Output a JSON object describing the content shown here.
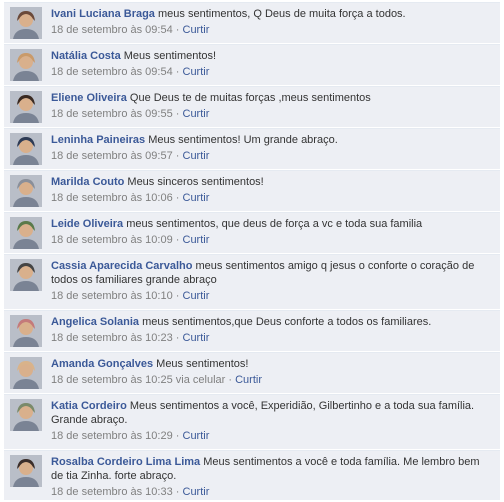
{
  "comments": [
    {
      "author": "Ivani Luciana Braga",
      "text": "meus sentimentos, Q Deus de muita força a todos.",
      "time": "18 de setembro às 09:54",
      "via": "",
      "like": "Curtir",
      "avatar_color": "#6b4a3a"
    },
    {
      "author": "Natália Costa",
      "text": "Meus sentimentos!",
      "time": "18 de setembro às 09:54",
      "via": "",
      "like": "Curtir",
      "avatar_color": "#c99a6a"
    },
    {
      "author": "Eliene Oliveira",
      "text": "Que Deus te de muitas forças ,meus sentimentos",
      "time": "18 de setembro às 09:55",
      "via": "",
      "like": "Curtir",
      "avatar_color": "#3a2a22"
    },
    {
      "author": "Leninha Paineiras",
      "text": "Meus sentimentos! Um grande abraço.",
      "time": "18 de setembro às 09:57",
      "via": "",
      "like": "Curtir",
      "avatar_color": "#2e3b55"
    },
    {
      "author": "Marilda Couto",
      "text": "Meus sinceros sentimentos!",
      "time": "18 de setembro às 10:06",
      "via": "",
      "like": "Curtir",
      "avatar_color": "#8a8f9a"
    },
    {
      "author": "Leide Oliveira",
      "text": "meus sentimentos, que deus de força a vc e toda sua familia",
      "time": "18 de setembro às 10:09",
      "via": "",
      "like": "Curtir",
      "avatar_color": "#5a7a4a"
    },
    {
      "author": "Cassia Aparecida Carvalho",
      "text": "meus sentimentos amigo q jesus o conforte o coração de todos os familiares grande abraço",
      "time": "18 de setembro às 10:10",
      "via": "",
      "like": "Curtir",
      "avatar_color": "#444444"
    },
    {
      "author": "Angelica Solania",
      "text": "meus sentimentos,que Deus conforte a todos os familiares.",
      "time": "18 de setembro às 10:23",
      "via": "",
      "like": "Curtir",
      "avatar_color": "#c47a7a"
    },
    {
      "author": "Amanda Gonçalves",
      "text": "Meus sentimentos!",
      "time": "18 de setembro às 10:25",
      "via": "via celular",
      "like": "Curtir",
      "avatar_color": "#d9b38a"
    },
    {
      "author": "Katia Cordeiro",
      "text": "Meus sentimentos a você, Experidião, Gilbertinho e a toda sua família. Grande abraço.",
      "time": "18 de setembro às 10:29",
      "via": "",
      "like": "Curtir",
      "avatar_color": "#7a8a6a"
    },
    {
      "author": "Rosalba Cordeiro Lima Lima",
      "text": "Meus sentimentos a você e toda família. Me lembro bem de tia Zinha. forte abraço.",
      "time": "18 de setembro às 10:33",
      "via": "",
      "like": "Curtir",
      "avatar_color": "#3b2e2a"
    }
  ]
}
